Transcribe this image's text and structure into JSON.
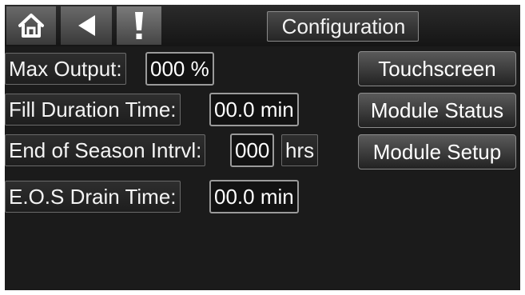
{
  "header": {
    "title": "Configuration",
    "home_icon": "home-icon",
    "back_icon": "back-arrow-icon",
    "alert_icon": "exclamation-alert-icon"
  },
  "settings": {
    "max_output": {
      "label": "Max Output:",
      "value": "000 %"
    },
    "fill_duration": {
      "label": "Fill Duration Time:",
      "value": "00.0 min"
    },
    "end_of_season": {
      "label": "End of Season Intrvl:",
      "value": "000",
      "unit": "hrs"
    },
    "eos_drain": {
      "label": "E.O.S Drain Time:",
      "value": "00.0 min"
    }
  },
  "nav": {
    "touchscreen": "Touchscreen",
    "module_status": "Module Status",
    "module_setup": "Module Setup"
  },
  "colors": {
    "background": "#1b1b1b",
    "text": "#ffffff",
    "border": "#9a9a9a"
  }
}
